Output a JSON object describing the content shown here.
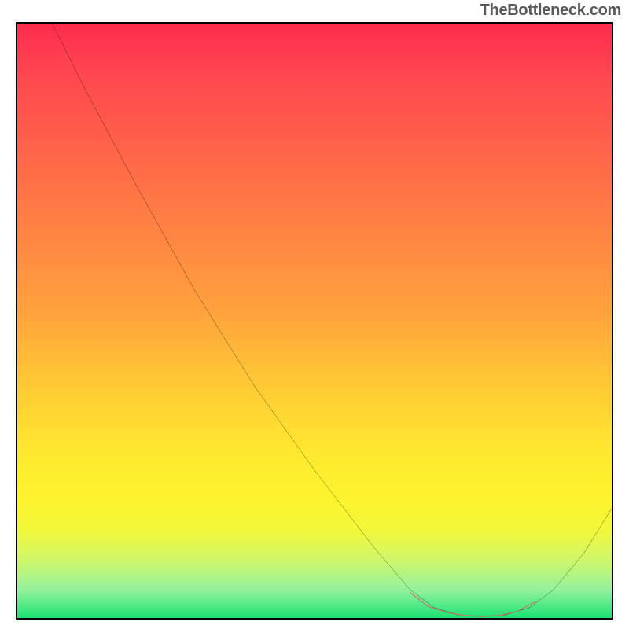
{
  "watermark": "TheBottleneck.com",
  "chart_data": {
    "type": "line",
    "title": "",
    "xlabel": "",
    "ylabel": "",
    "xlim": [
      0,
      100
    ],
    "ylim": [
      0,
      100
    ],
    "grid": false,
    "series": [
      {
        "name": "curve",
        "color": "#000000",
        "points": [
          {
            "x": 6,
            "y": 100
          },
          {
            "x": 12,
            "y": 88
          },
          {
            "x": 20,
            "y": 73
          },
          {
            "x": 30,
            "y": 55
          },
          {
            "x": 40,
            "y": 39
          },
          {
            "x": 50,
            "y": 25
          },
          {
            "x": 60,
            "y": 12
          },
          {
            "x": 66,
            "y": 5
          },
          {
            "x": 70,
            "y": 2
          },
          {
            "x": 74,
            "y": 0.8
          },
          {
            "x": 78,
            "y": 0.5
          },
          {
            "x": 82,
            "y": 0.8
          },
          {
            "x": 86,
            "y": 2
          },
          {
            "x": 90,
            "y": 5
          },
          {
            "x": 95,
            "y": 11
          },
          {
            "x": 100,
            "y": 19
          }
        ]
      },
      {
        "name": "highlight-flat-region",
        "color": "#d86a6a",
        "points": [
          {
            "x": 66,
            "y": 4.5
          },
          {
            "x": 69,
            "y": 2.2
          },
          {
            "x": 72,
            "y": 1.2
          },
          {
            "x": 75,
            "y": 0.7
          },
          {
            "x": 78,
            "y": 0.5
          },
          {
            "x": 81,
            "y": 0.7
          },
          {
            "x": 84,
            "y": 1.4
          },
          {
            "x": 87,
            "y": 3.0
          }
        ]
      }
    ],
    "background_gradient": {
      "top": "#ff2a4e",
      "mid": "#ffe82f",
      "bottom": "#18db66"
    }
  }
}
